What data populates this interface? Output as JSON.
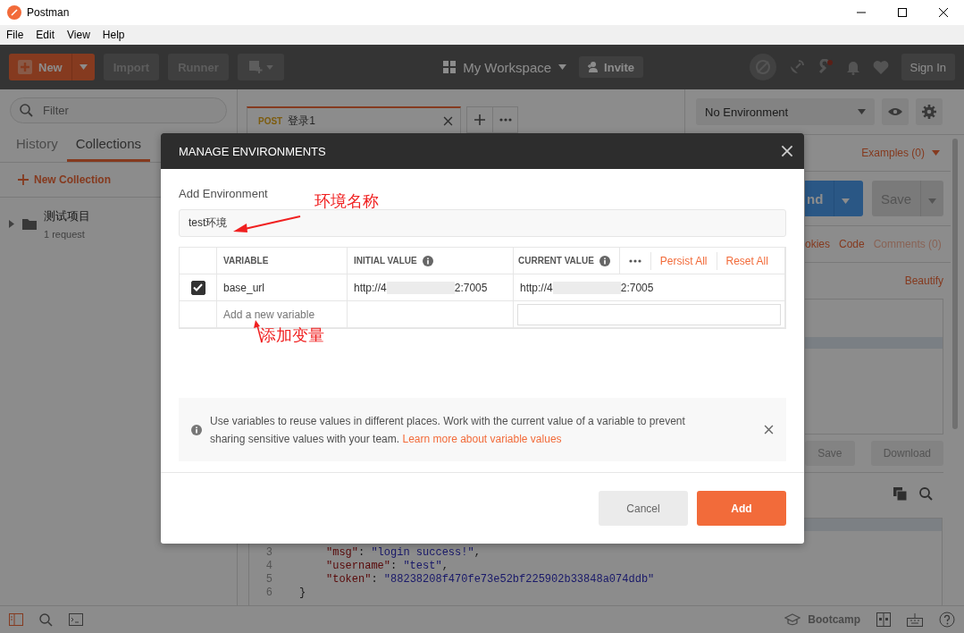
{
  "window": {
    "title": "Postman"
  },
  "menu": [
    "File",
    "Edit",
    "View",
    "Help"
  ],
  "toolbar": {
    "new_label": "New",
    "import_label": "Import",
    "runner_label": "Runner",
    "workspace": "My Workspace",
    "invite": "Invite",
    "sign_in": "Sign In"
  },
  "sidebar": {
    "filter_placeholder": "Filter",
    "tabs": [
      {
        "label": "History",
        "selected": false
      },
      {
        "label": "Collections",
        "selected": true
      }
    ],
    "new_collection": "New Collection",
    "collections": [
      {
        "name": "测试项目",
        "count": "1 request",
        "expanded": false
      }
    ]
  },
  "request_tabs": [
    {
      "method": "POST",
      "name": "登录1",
      "selected": true
    }
  ],
  "environment_select": "No Environment",
  "request_panel": {
    "examples": "Examples (0)",
    "send_visible": "nd",
    "save": "Save",
    "links": [
      {
        "label": "okies",
        "disabled": false
      },
      {
        "label": "Code",
        "disabled": false
      },
      {
        "label": "Comments (0)",
        "disabled": true
      }
    ],
    "beautify": "Beautify"
  },
  "response": {
    "buttons": [
      "Save",
      "Download"
    ],
    "lines": [
      {
        "number": "3",
        "kind": "pair",
        "key": "\"msg\"",
        "sep": ":",
        "value": "\"login success!\"",
        "end": ","
      },
      {
        "number": "4",
        "kind": "pair",
        "key": "\"username\"",
        "sep": ":",
        "value": "\"test\"",
        "end": ","
      },
      {
        "number": "5",
        "kind": "pair",
        "key": "\"token\"",
        "sep": ":",
        "value": "\"88238208f470fe73e52bf225902b33848a074ddb\""
      },
      {
        "number": "6",
        "kind": "brace",
        "text": "}"
      }
    ]
  },
  "status_bar": {
    "bootcamp": "Bootcamp"
  },
  "dialog": {
    "title": "MANAGE ENVIRONMENTS",
    "section_label": "Add Environment",
    "name_value": "test环境",
    "columns": [
      {
        "label": "VARIABLE",
        "info": false
      },
      {
        "label": "INITIAL VALUE",
        "info": true
      },
      {
        "label": "CURRENT VALUE",
        "info": true
      }
    ],
    "persist_all": "Persist All",
    "reset_all": "Reset All",
    "rows": [
      {
        "checked": true,
        "variable": "base_url",
        "initial_start": "http://4",
        "initial_end": "2:7005",
        "current_start": "http://4",
        "current_end": "2:7005"
      }
    ],
    "new_variable_placeholder": "Add a new variable",
    "info": "Use variables to reuse values in different places. Work with the current value of a variable to prevent sharing sensitive values with your team.",
    "info_link": "Learn more about variable values",
    "buttons": [
      {
        "label": "Cancel",
        "kind": "secondary"
      },
      {
        "label": "Add",
        "kind": "primary"
      }
    ]
  },
  "annotations": [
    {
      "text": "环境名称"
    },
    {
      "text": "添加变量"
    }
  ]
}
